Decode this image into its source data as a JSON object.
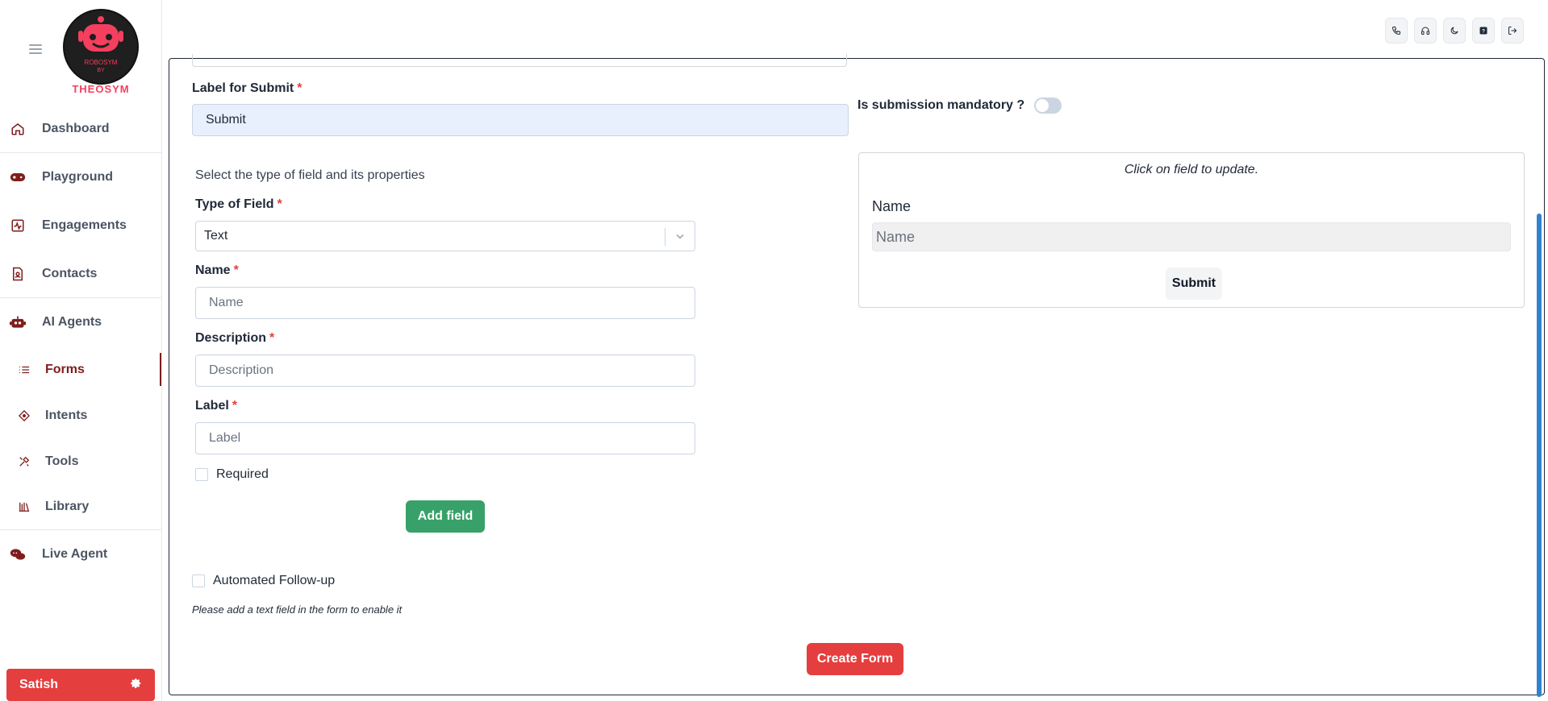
{
  "brand": {
    "logo_text_top": "ROBOSYM",
    "logo_text_by": "BY",
    "logo_text_bottom": "THEOSYM"
  },
  "sidebar": {
    "items": [
      {
        "label": "Dashboard",
        "icon": "home-icon"
      },
      {
        "label": "Playground",
        "icon": "gamepad-icon"
      },
      {
        "label": "Engagements",
        "icon": "activity-icon"
      },
      {
        "label": "Contacts",
        "icon": "contact-icon"
      },
      {
        "label": "AI Agents",
        "icon": "robot-icon"
      },
      {
        "label": "Forms",
        "icon": "list-icon",
        "active": true
      },
      {
        "label": "Intents",
        "icon": "target-icon"
      },
      {
        "label": "Tools",
        "icon": "tools-icon"
      },
      {
        "label": "Library",
        "icon": "library-icon"
      },
      {
        "label": "Live Agent",
        "icon": "chat-icon"
      }
    ],
    "user": {
      "name": "Satish"
    }
  },
  "topbar": {
    "icons": [
      "phone-icon",
      "headset-icon",
      "moon-icon",
      "help-icon",
      "logout-icon"
    ]
  },
  "form": {
    "submit_label_title": "Label for Submit",
    "submit_label_value": "Submit",
    "mandatory_label": "Is submission mandatory ?",
    "mandatory_on": false,
    "helper_text": "Select the type of field and its properties",
    "type_label": "Type of Field",
    "type_value": "Text",
    "name_label": "Name",
    "name_placeholder": "Name",
    "description_label": "Description",
    "description_placeholder": "Description",
    "label_label": "Label",
    "label_placeholder": "Label",
    "required_label": "Required",
    "add_field_button": "Add field",
    "followup_label": "Automated Follow-up",
    "followup_note": "Please add a text field in the form to enable it",
    "create_button": "Create Form"
  },
  "preview": {
    "hint": "Click on field to update.",
    "field_label": "Name",
    "field_placeholder": "Name",
    "submit_button": "Submit"
  },
  "colors": {
    "accent": "#7f1d1d",
    "danger": "#e53e3e",
    "success": "#38a169",
    "autofill": "#e8f0fe"
  }
}
